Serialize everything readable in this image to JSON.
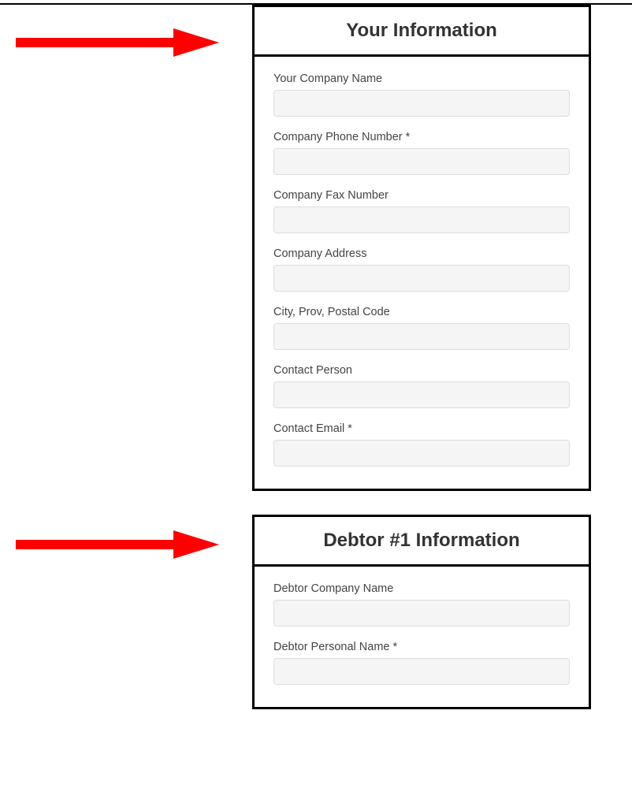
{
  "sections": [
    {
      "title": "Your Information",
      "fields": [
        {
          "label": "Your Company Name"
        },
        {
          "label": "Company Phone Number *"
        },
        {
          "label": "Company Fax Number"
        },
        {
          "label": "Company Address"
        },
        {
          "label": "City, Prov, Postal Code"
        },
        {
          "label": "Contact Person"
        },
        {
          "label": "Contact Email *"
        }
      ]
    },
    {
      "title": "Debtor #1 Information",
      "fields": [
        {
          "label": "Debtor Company Name"
        },
        {
          "label": "Debtor Personal Name *"
        }
      ]
    }
  ],
  "arrow_color": "#ff0000"
}
